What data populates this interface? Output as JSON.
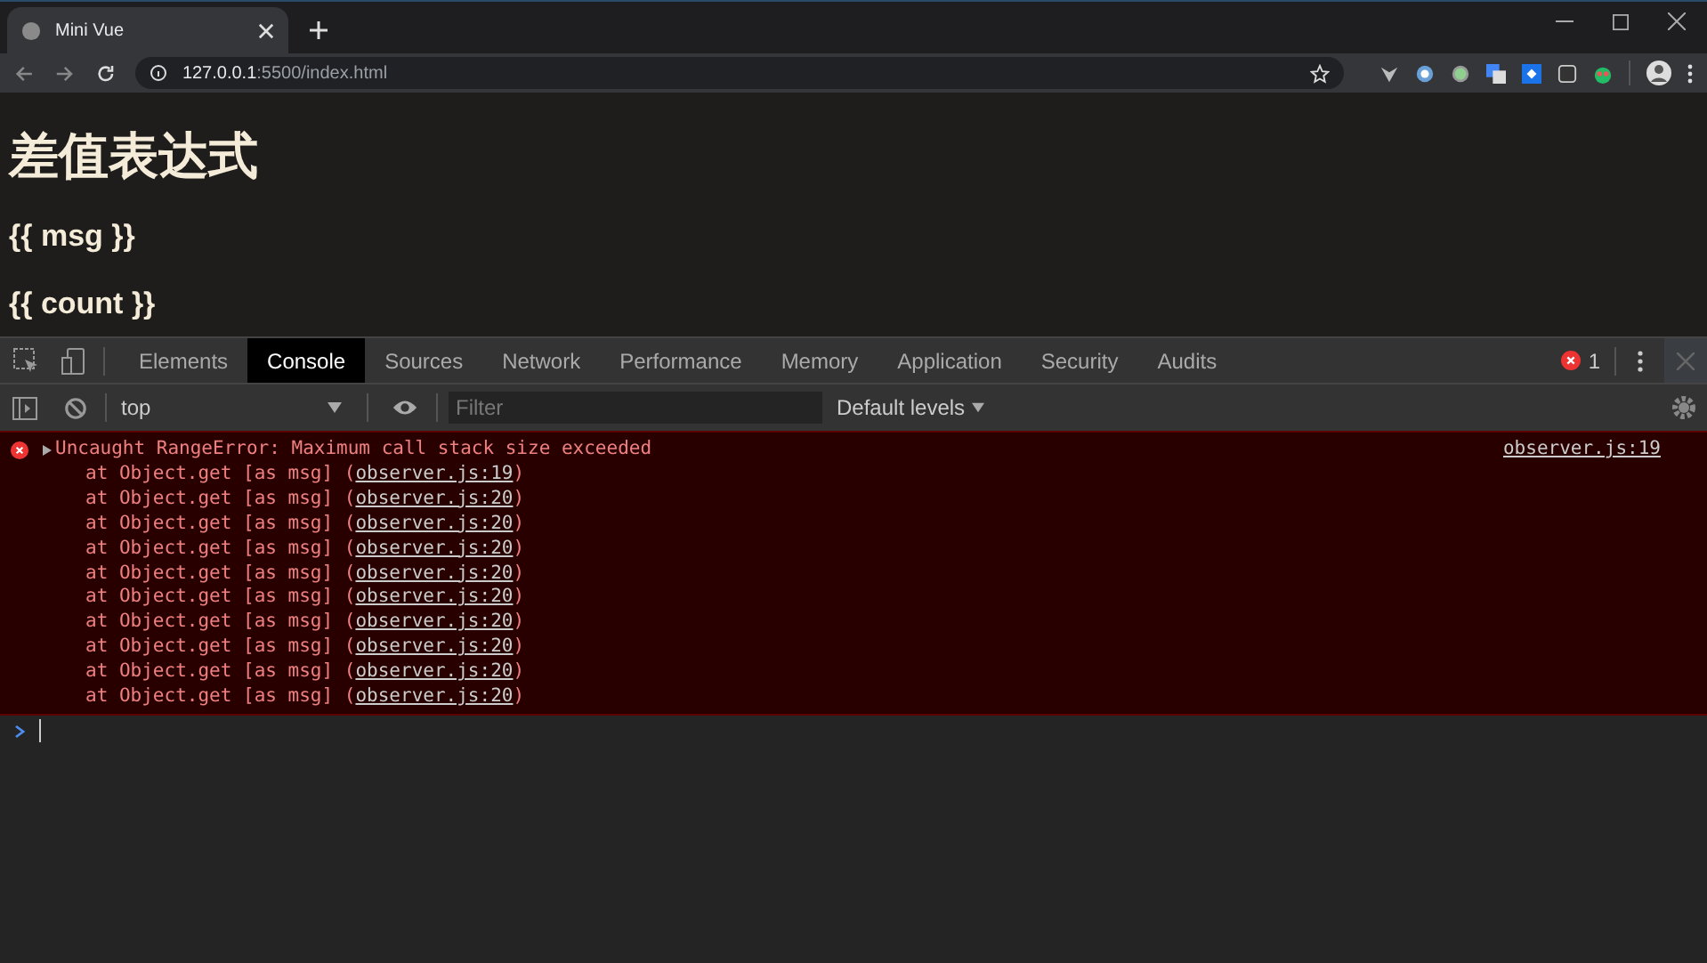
{
  "browser": {
    "tab_title": "Mini Vue",
    "url_host": "127.0.0.1",
    "url_rest": ":5500/index.html"
  },
  "page": {
    "heading": "差值表达式",
    "lines": [
      "{{ msg }}",
      "{{ count }}"
    ]
  },
  "devtools": {
    "tabs": [
      {
        "label": "Elements",
        "selected": false
      },
      {
        "label": "Console",
        "selected": true
      },
      {
        "label": "Sources",
        "selected": false
      },
      {
        "label": "Network",
        "selected": false
      },
      {
        "label": "Performance",
        "selected": false
      },
      {
        "label": "Memory",
        "selected": false
      },
      {
        "label": "Application",
        "selected": false
      },
      {
        "label": "Security",
        "selected": false
      },
      {
        "label": "Audits",
        "selected": false
      }
    ],
    "error_count": "1",
    "context": "top",
    "filter_placeholder": "Filter",
    "levels": "Default levels",
    "error": {
      "message": "Uncaught RangeError: Maximum call stack size exceeded",
      "source": "observer.js:19",
      "stack": [
        {
          "text": "at Object.get [as msg] (",
          "link": "observer.js:19",
          "close": ")"
        },
        {
          "text": "at Object.get [as msg] (",
          "link": "observer.js:20",
          "close": ")"
        },
        {
          "text": "at Object.get [as msg] (",
          "link": "observer.js:20",
          "close": ")"
        },
        {
          "text": "at Object.get [as msg] (",
          "link": "observer.js:20",
          "close": ")"
        },
        {
          "text": "at Object.get [as msg] (",
          "link": "observer.js:20",
          "close": ")"
        },
        {
          "text": "at Object.get [as msg] (",
          "link": "observer.js:20",
          "close": ")"
        },
        {
          "text": "at Object.get [as msg] (",
          "link": "observer.js:20",
          "close": ")"
        },
        {
          "text": "at Object.get [as msg] (",
          "link": "observer.js:20",
          "close": ")"
        },
        {
          "text": "at Object.get [as msg] (",
          "link": "observer.js:20",
          "close": ")"
        },
        {
          "text": "at Object.get [as msg] (",
          "link": "observer.js:20",
          "close": ")"
        }
      ]
    }
  }
}
